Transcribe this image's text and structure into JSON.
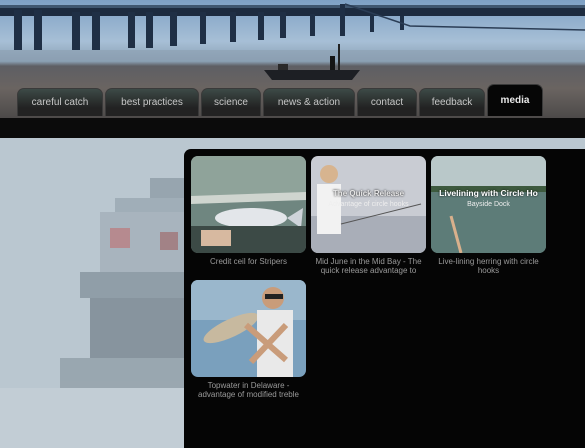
{
  "nav": {
    "tabs": [
      {
        "label": "careful catch"
      },
      {
        "label": "best practices"
      },
      {
        "label": "science"
      },
      {
        "label": "news & action"
      },
      {
        "label": "contact"
      },
      {
        "label": "feedback"
      },
      {
        "label": "media",
        "active": true
      }
    ]
  },
  "videos": [
    {
      "caption": "Credit ceil for Stripers"
    },
    {
      "caption": "Mid June in the Mid Bay - The quick release advantage to",
      "overlay_title": "The Quick Release",
      "overlay_sub": "Advantage of circle hooks"
    },
    {
      "caption": "Live-lining herring with circle hooks",
      "overlay_title": "Livelining with Circle Ho",
      "overlay_sub": "Bayside Dock"
    },
    {
      "caption": "Topwater in Delaware - advantage of modified treble"
    }
  ],
  "colors": {
    "panel": "#050505",
    "tab_bg": "#222222",
    "header_water": "#6a6461"
  }
}
